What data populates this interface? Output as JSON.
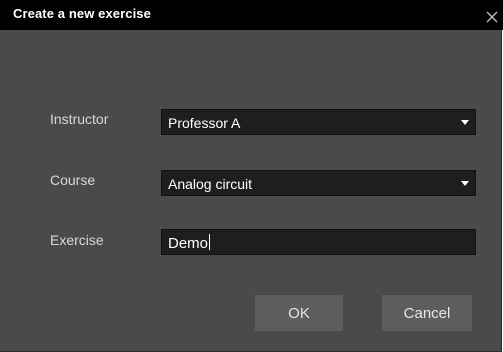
{
  "dialog": {
    "title": "Create a new exercise",
    "close_icon": "close-icon"
  },
  "form": {
    "instructor": {
      "label": "Instructor",
      "value": "Professor A"
    },
    "course": {
      "label": "Course",
      "value": "Analog circuit"
    },
    "exercise": {
      "label": "Exercise",
      "value": "Demo"
    }
  },
  "buttons": {
    "ok": "OK",
    "cancel": "Cancel"
  }
}
